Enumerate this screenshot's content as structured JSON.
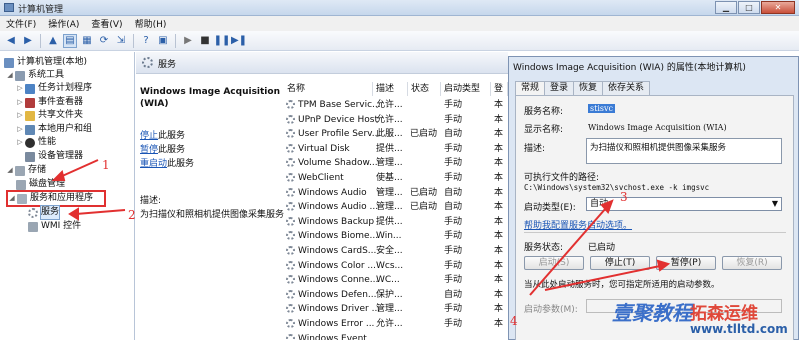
{
  "window": {
    "title": "计算机管理"
  },
  "menu": [
    "文件(F)",
    "操作(A)",
    "查看(V)",
    "帮助(H)"
  ],
  "tree": {
    "root": "计算机管理(本地)",
    "system_tools": "系统工具",
    "task_scheduler": "任务计划程序",
    "event_viewer": "事件查看器",
    "shared_folders": "共享文件夹",
    "local_users": "本地用户和组",
    "performance": "性能",
    "device_manager": "设备管理器",
    "storage": "存储",
    "disk_management": "磁盘管理",
    "services_apps": "服务和应用程序",
    "services": "服务",
    "wmi": "WMI 控件"
  },
  "panel": {
    "header": "服务",
    "desc_title": "Windows Image Acquisition (WIA)",
    "stop": "停止",
    "stop_suffix": "此服务",
    "pause": "暂停",
    "pause_suffix": "此服务",
    "restart": "重启动",
    "restart_suffix": "此服务",
    "desc_label": "描述:",
    "desc_text": "为扫描仪和照相机提供图像采集服务"
  },
  "columns": [
    "名称",
    "描述",
    "状态",
    "启动类型",
    "登"
  ],
  "services": [
    {
      "name": "TPM Base Servic...",
      "desc": "允许...",
      "status": "",
      "startup": "手动",
      "logon": "本"
    },
    {
      "name": "UPnP Device Host",
      "desc": "允许...",
      "status": "",
      "startup": "手动",
      "logon": "本"
    },
    {
      "name": "User Profile Serv...",
      "desc": "此服...",
      "status": "已启动",
      "startup": "自动",
      "logon": "本"
    },
    {
      "name": "Virtual Disk",
      "desc": "提供...",
      "status": "",
      "startup": "手动",
      "logon": "本"
    },
    {
      "name": "Volume Shadow...",
      "desc": "管理...",
      "status": "",
      "startup": "手动",
      "logon": "本"
    },
    {
      "name": "WebClient",
      "desc": "使基...",
      "status": "",
      "startup": "手动",
      "logon": "本"
    },
    {
      "name": "Windows Audio",
      "desc": "管理...",
      "status": "已启动",
      "startup": "自动",
      "logon": "本"
    },
    {
      "name": "Windows Audio ...",
      "desc": "管理...",
      "status": "已启动",
      "startup": "自动",
      "logon": "本"
    },
    {
      "name": "Windows Backup",
      "desc": "提供...",
      "status": "",
      "startup": "手动",
      "logon": "本"
    },
    {
      "name": "Windows Biome...",
      "desc": "Win...",
      "status": "",
      "startup": "手动",
      "logon": "本"
    },
    {
      "name": "Windows CardS...",
      "desc": "安全...",
      "status": "",
      "startup": "手动",
      "logon": "本"
    },
    {
      "name": "Windows Color ...",
      "desc": "Wcs...",
      "status": "",
      "startup": "手动",
      "logon": "本"
    },
    {
      "name": "Windows Conne...",
      "desc": "WC...",
      "status": "",
      "startup": "手动",
      "logon": "本"
    },
    {
      "name": "Windows Defen...",
      "desc": "保护...",
      "status": "",
      "startup": "自动",
      "logon": "本"
    },
    {
      "name": "Windows Driver ...",
      "desc": "管理...",
      "status": "",
      "startup": "手动",
      "logon": "本"
    },
    {
      "name": "Windows Error ...",
      "desc": "允许...",
      "status": "",
      "startup": "手动",
      "logon": "本"
    },
    {
      "name": "Windows Event",
      "desc": "",
      "status": "",
      "startup": "",
      "logon": ""
    }
  ],
  "dialog": {
    "title": "Windows Image Acquisition (WIA) 的属性(本地计算机)",
    "tabs": [
      "常规",
      "登录",
      "恢复",
      "依存关系"
    ],
    "svc_name_label": "服务名称:",
    "svc_name": "stisvc",
    "display_label": "显示名称:",
    "display_value": "Windows Image Acquisition (WIA)",
    "desc_label": "描述:",
    "desc_value": "为扫描仪和照相机提供图像采集服务",
    "path_label": "可执行文件的路径:",
    "path_value": "C:\\Windows\\system32\\svchost.exe -k imgsvc",
    "startup_label": "启动类型(E):",
    "startup_value": "自动",
    "help_link": "帮助我配置服务启动选项。",
    "status_label": "服务状态:",
    "status_value": "已启动",
    "btn_start": "启动(S)",
    "btn_stop": "停止(T)",
    "btn_pause": "暂停(P)",
    "btn_resume": "恢复(R)",
    "hint": "当从此处启动服务时，您可指定所适用的启动参数。",
    "params_label": "启动参数(M):"
  },
  "annotations": [
    "1",
    "2",
    "3",
    "4"
  ],
  "watermark": {
    "line1": "壹聚教程",
    "line2": "拓森运维",
    "url": "www.tlltd.com"
  },
  "colors": {
    "annotation": "#e23030",
    "selection": "#3a7bd5"
  }
}
